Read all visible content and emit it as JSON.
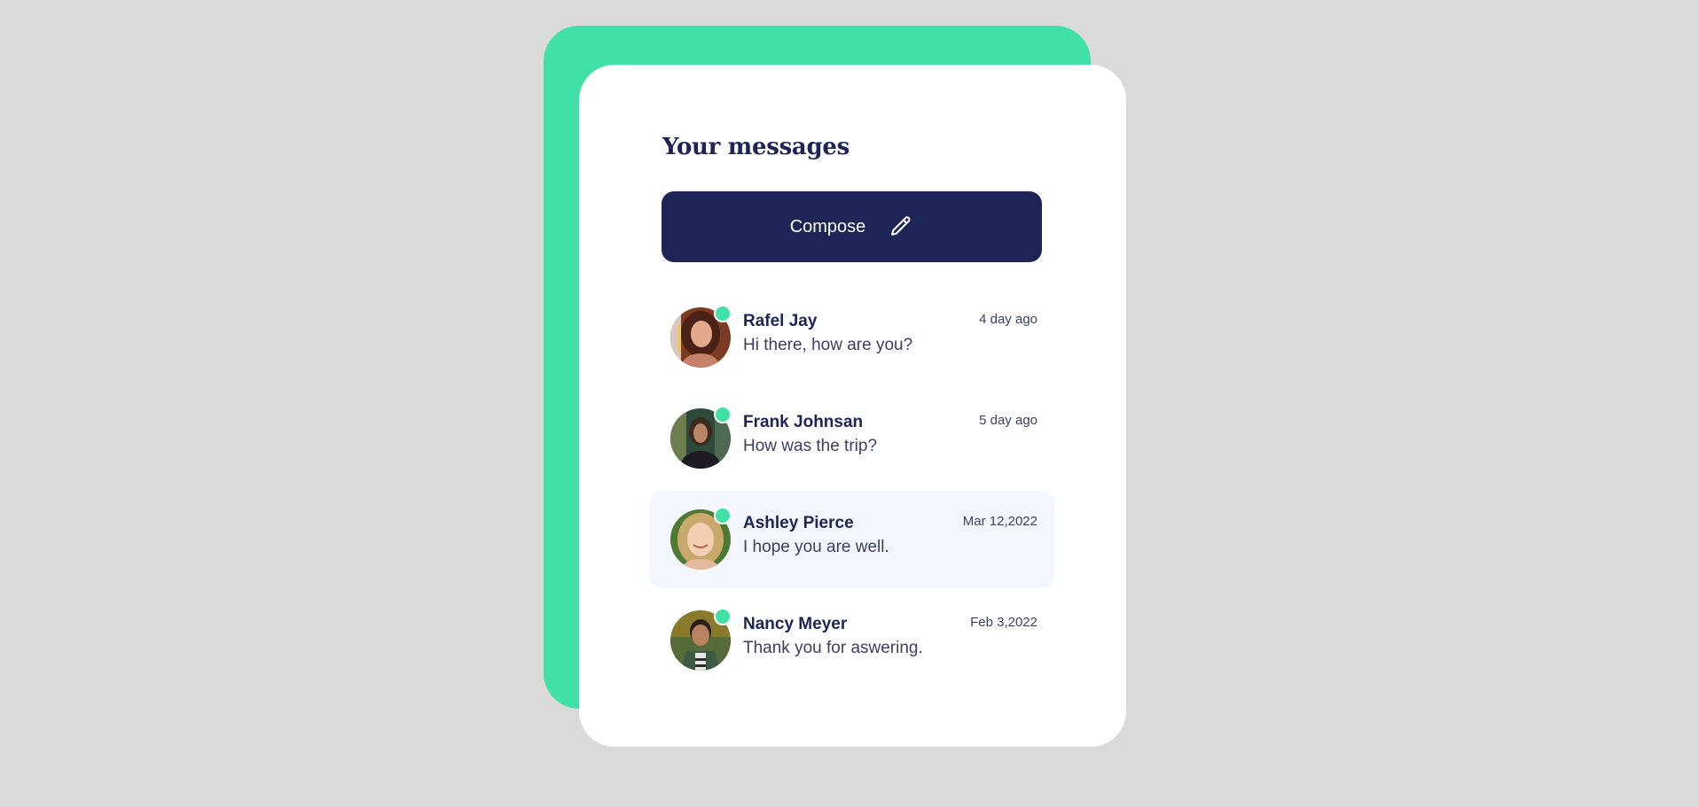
{
  "colors": {
    "background": "#dadada",
    "accent": "#40e0a6",
    "primary": "#1e2456",
    "text": "#1e2456",
    "muted": "#3b4063",
    "highlight": "#f3f6fd"
  },
  "header": {
    "title": "Your messages"
  },
  "compose": {
    "label": "Compose",
    "icon": "pencil-icon"
  },
  "messages": [
    {
      "name": "Rafel Jay",
      "preview": "Hi there, how are you?",
      "time": "4 day ago",
      "online": true,
      "active": false
    },
    {
      "name": "Frank Johnsan",
      "preview": "How was the trip?",
      "time": "5 day ago",
      "online": true,
      "active": false
    },
    {
      "name": "Ashley Pierce",
      "preview": "I hope you are well.",
      "time": "Mar 12,2022",
      "online": true,
      "active": true
    },
    {
      "name": "Nancy Meyer",
      "preview": "Thank you for aswering.",
      "time": "Feb 3,2022",
      "online": true,
      "active": false
    }
  ]
}
